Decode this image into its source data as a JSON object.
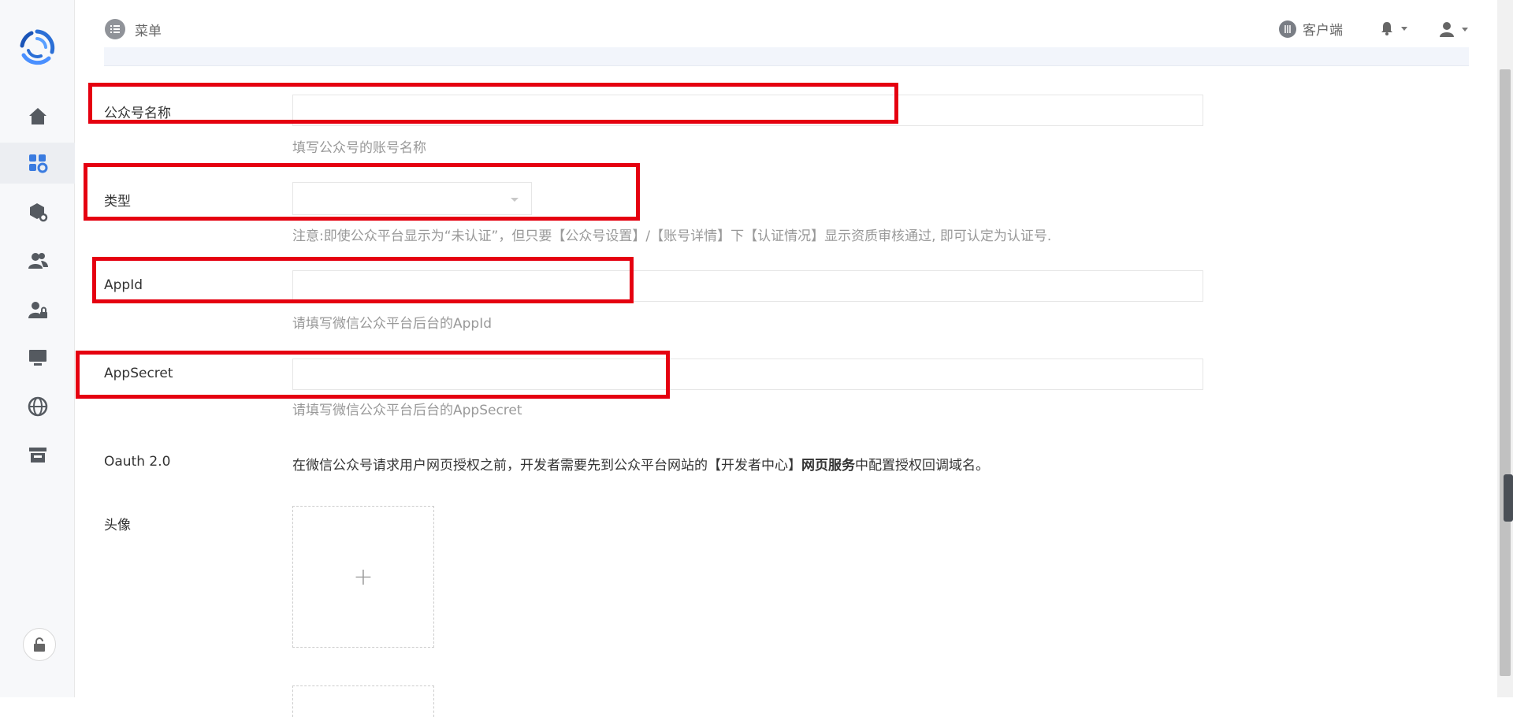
{
  "header": {
    "menu_label": "菜单",
    "client_label": "客户端"
  },
  "sidebar": {
    "items": [
      {
        "icon": "home-icon"
      },
      {
        "icon": "apps-settings-icon",
        "active": true
      },
      {
        "icon": "box-settings-icon"
      },
      {
        "icon": "users-icon"
      },
      {
        "icon": "user-lock-icon"
      },
      {
        "icon": "monitor-icon"
      },
      {
        "icon": "globe-icon"
      },
      {
        "icon": "store-icon"
      }
    ]
  },
  "form": {
    "name_label": "公众号名称",
    "name_value": "",
    "name_help": "填写公众号的账号名称",
    "type_label": "类型",
    "type_value": "",
    "type_help": "注意:即使公众平台显示为“未认证”，但只要【公众号设置】/【账号详情】下【认证情况】显示资质审核通过, 即可认定为认证号.",
    "appid_label": "AppId",
    "appid_value": "",
    "appid_help": "请填写微信公众平台后台的AppId",
    "appsecret_label": "AppSecret",
    "appsecret_value": "",
    "appsecret_help": "请填写微信公众平台后台的AppSecret",
    "oauth_label": "Oauth 2.0",
    "oauth_text_before": "在微信公众号请求用户网页授权之前，开发者需要先到公众平台网站的【开发者中心】",
    "oauth_text_bold": "网页服务",
    "oauth_text_after": "中配置授权回调域名。",
    "avatar_label": "头像",
    "upload_plus": "+"
  },
  "colors": {
    "highlight": "#e50010",
    "logo": "#2b6fd6",
    "nav_icon": "#555a60",
    "nav_active_icon": "#3a7be0"
  }
}
